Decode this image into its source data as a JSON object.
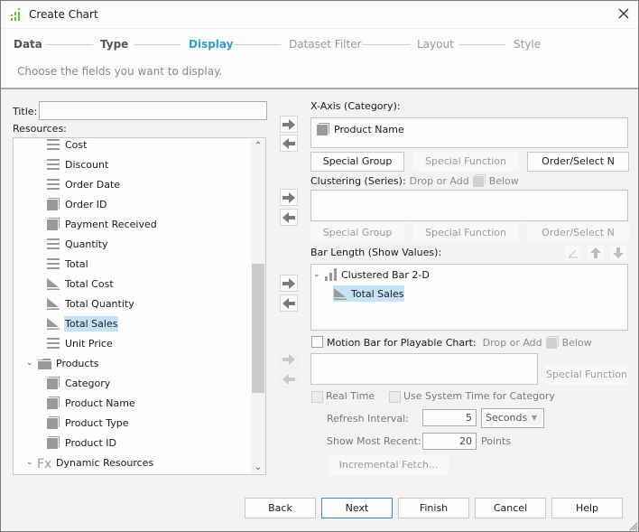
{
  "window": {
    "title": "Create Chart",
    "close_label": "×"
  },
  "steps": [
    {
      "label": "Data",
      "state": "done"
    },
    {
      "label": "Type",
      "state": "done"
    },
    {
      "label": "Display",
      "state": "active"
    },
    {
      "label": "Dataset Filter",
      "state": "future"
    },
    {
      "label": "Layout",
      "state": "future"
    },
    {
      "label": "Style",
      "state": "future"
    }
  ],
  "subtitle": "Choose the fields you want to display.",
  "left": {
    "title_label": "Title:",
    "title_value": "",
    "resources_label": "Resources:",
    "tree": [
      {
        "label": "Cost",
        "icon": "field-icon"
      },
      {
        "label": "Discount",
        "icon": "field-icon"
      },
      {
        "label": "Order Date",
        "icon": "field-icon"
      },
      {
        "label": "Order ID",
        "icon": "dimension-icon"
      },
      {
        "label": "Payment Received",
        "icon": "dimension-icon"
      },
      {
        "label": "Quantity",
        "icon": "field-icon"
      },
      {
        "label": "Total",
        "icon": "field-icon"
      },
      {
        "label": "Total Cost",
        "icon": "measure-icon"
      },
      {
        "label": "Total Quantity",
        "icon": "measure-icon"
      },
      {
        "label": "Total Sales",
        "icon": "measure-icon",
        "selected": true
      },
      {
        "label": "Unit Price",
        "icon": "field-icon"
      },
      {
        "label": "Products",
        "icon": "folder-icon",
        "expanded": true
      },
      {
        "label": "Category",
        "icon": "dimension-icon"
      },
      {
        "label": "Product Name",
        "icon": "dimension-icon"
      },
      {
        "label": "Product Type",
        "icon": "dimension-icon"
      },
      {
        "label": "Product ID",
        "icon": "dimension-icon"
      },
      {
        "label": "Dynamic Resources",
        "icon": "formula-icon",
        "expanded": true
      }
    ]
  },
  "xaxis": {
    "label": "X-Axis (Category):",
    "items": [
      "Product Name"
    ],
    "buttons": {
      "special_group": "Special Group",
      "special_function": "Special Function",
      "order_select": "Order/Select N"
    }
  },
  "clustering": {
    "label": "Clustering (Series):",
    "hint_pre": "Drop or Add",
    "hint_post": "Below",
    "buttons": {
      "special_group": "Special Group",
      "special_function": "Special Function",
      "order_select": "Order/Select N"
    }
  },
  "bar_length": {
    "label": "Bar Length (Show Values):",
    "group": "Clustered Bar 2-D",
    "items": [
      "Total Sales"
    ]
  },
  "motion": {
    "label": "Motion Bar for Playable Chart:",
    "hint_pre": "Drop or Add",
    "hint_post": "Below",
    "special_function": "Special Function"
  },
  "realtime": {
    "real_time_label": "Real Time",
    "system_time_label": "Use System Time for Category",
    "refresh_label": "Refresh Interval:",
    "refresh_value": "5",
    "refresh_unit": "Seconds",
    "recent_label": "Show Most Recent:",
    "recent_value": "20",
    "recent_unit": "Points",
    "incremental": "Incremental Fetch..."
  },
  "footer": {
    "back": "Back",
    "next": "Next",
    "finish": "Finish",
    "cancel": "Cancel",
    "help": "Help"
  }
}
